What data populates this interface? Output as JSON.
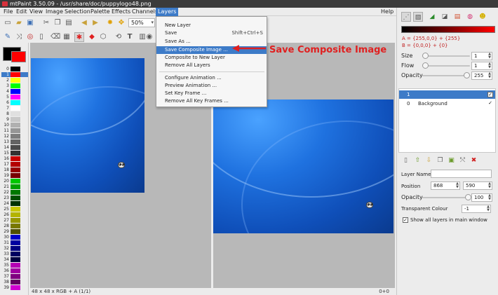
{
  "window": {
    "title": "mtPaint 3.50.09 - /usr/share/doc/puppylogo48.png"
  },
  "menu": {
    "items": [
      "File",
      "Edit",
      "View",
      "Image",
      "Selection",
      "Palette",
      "Effects",
      "Channels",
      "Layers"
    ],
    "help": "Help",
    "active": "Layers"
  },
  "toolbar": {
    "zoom_value": "50%"
  },
  "layers_menu": {
    "items": [
      {
        "label": "New Layer",
        "shortcut": ""
      },
      {
        "label": "Save",
        "shortcut": "Shift+Ctrl+S"
      },
      {
        "label": "Save As ...",
        "shortcut": ""
      },
      {
        "label": "Save Composite Image ...",
        "shortcut": "",
        "highlighted": true
      },
      {
        "label": "Composite to New Layer",
        "shortcut": ""
      },
      {
        "label": "Remove All Layers",
        "shortcut": ""
      },
      {
        "label": "Configure Animation ...",
        "shortcut": ""
      },
      {
        "label": "Preview Animation ...",
        "shortcut": ""
      },
      {
        "label": "Set Key Frame ...",
        "shortcut": ""
      },
      {
        "label": "Remove All Key Frames ...",
        "shortcut": ""
      }
    ]
  },
  "annotation": {
    "text": "Save Composite Image"
  },
  "palette": {
    "numbers": [
      "0",
      "1",
      "2",
      "3",
      "4",
      "5",
      "6",
      "7",
      "8",
      "9",
      "10",
      "11",
      "12",
      "13",
      "14",
      "15",
      "16",
      "17",
      "18",
      "19",
      "20",
      "21",
      "22",
      "23",
      "24",
      "25",
      "26",
      "27",
      "28",
      "29",
      "30",
      "31",
      "32",
      "33",
      "34",
      "35",
      "36",
      "37",
      "38",
      "39"
    ],
    "colors": [
      "#000000",
      "#ff0000",
      "#ffff00",
      "#00ff00",
      "#0000ff",
      "#ff00ff",
      "#00ffff",
      "#ffffff",
      "#e0e0e0",
      "#c8c8c8",
      "#b0b0b0",
      "#969696",
      "#7d7d7d",
      "#646464",
      "#4b4b4b",
      "#323232",
      "#c80000",
      "#b40000",
      "#960000",
      "#780000",
      "#00c800",
      "#00a000",
      "#007800",
      "#005000",
      "#003200",
      "#c8c800",
      "#b4b400",
      "#969600",
      "#787800",
      "#505000",
      "#0000c8",
      "#0000a0",
      "#000080",
      "#000060",
      "#000040",
      "#b400b4",
      "#a000a0",
      "#800080",
      "#600060",
      "#d000d0"
    ],
    "selected_index": 1
  },
  "status": {
    "left": "48 x 48 x RGB + A  (1/1)",
    "right": "0+0"
  },
  "color_panel": {
    "a_value": "A = {255,0,0} + {255}",
    "b_value": "B = {0,0,0} + {0}",
    "size_label": "Size",
    "size_value": "1",
    "size_level": 0,
    "flow_label": "Flow",
    "flow_value": "1",
    "flow_level": 0,
    "opacity_label": "Opacity",
    "opacity_value": "255",
    "opacity_level": 1
  },
  "layers": [
    {
      "index": "1",
      "name": "",
      "visible": true,
      "selected": true
    },
    {
      "index": "0",
      "name": "Background",
      "visible": true,
      "selected": false
    }
  ],
  "layer_props": {
    "name_label": "Layer Name",
    "name_value": "",
    "position_label": "Position",
    "pos_x": "868",
    "pos_y": "590",
    "opacity_label": "Opacity",
    "opacity_value": "100",
    "opacity_level": 1,
    "transparent_label": "Transparent Colour",
    "transparent_value": "-1",
    "show_all_label": "Show all layers in main window",
    "show_all_checked": true
  }
}
